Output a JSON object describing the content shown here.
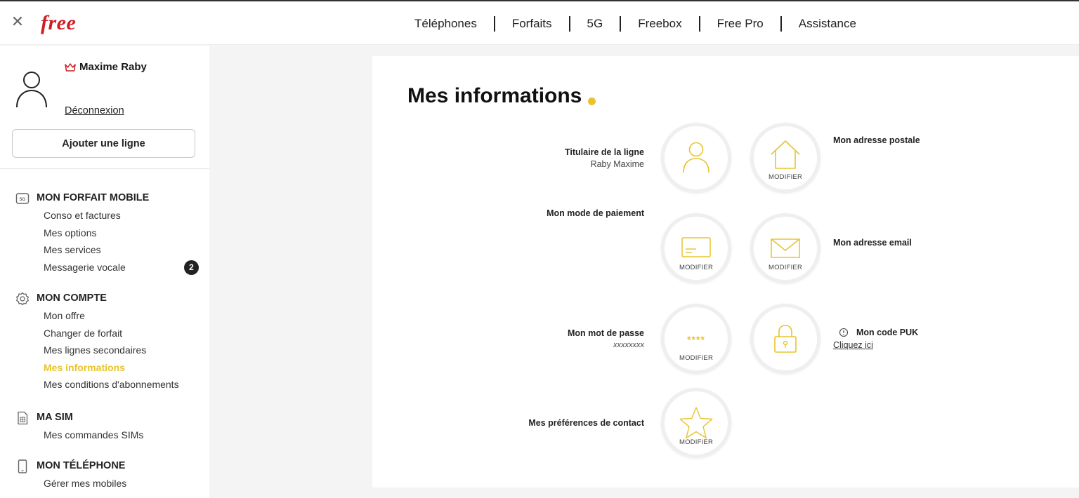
{
  "brand": {
    "logo_text": "free",
    "accent": "#cd1e25",
    "highlight": "#e8c32e"
  },
  "topbar": {
    "close_icon": "close-icon",
    "nav": [
      "Téléphones",
      "Forfaits",
      "5G",
      "Freebox",
      "Free Pro",
      "Assistance"
    ]
  },
  "sidebar": {
    "user_name": "Maxime Raby",
    "logout": "Déconnexion",
    "add_line": "Ajouter une ligne",
    "sections": [
      {
        "icon": "5g-icon",
        "title": "MON FORFAIT MOBILE",
        "links": [
          "Conso et factures",
          "Mes options",
          "Mes services",
          "Messagerie vocale"
        ],
        "badge": "2"
      },
      {
        "icon": "gear-icon",
        "title": "MON COMPTE",
        "links": [
          "Mon offre",
          "Changer de forfait",
          "Mes lignes secondaires",
          "Mes informations",
          "Mes conditions d'abonnements"
        ],
        "active": "Mes informations"
      },
      {
        "icon": "sim-icon",
        "title": "MA SIM",
        "links": [
          "Mes commandes SIMs"
        ]
      },
      {
        "icon": "phone-icon",
        "title": "MON TÉLÉPHONE",
        "links": [
          "Gérer mes mobiles"
        ]
      }
    ]
  },
  "main": {
    "title": "Mes informations",
    "modifier": "MODIFIER",
    "titulaire": {
      "label": "Titulaire de la ligne",
      "value": "Raby Maxime"
    },
    "adresse_postale": {
      "label": "Mon adresse postale"
    },
    "paiement": {
      "label": "Mon mode de paiement"
    },
    "email": {
      "label": "Mon adresse email"
    },
    "password": {
      "label": "Mon mot de passe",
      "value": "xxxxxxxx",
      "stars": "****"
    },
    "puk": {
      "label": "Mon code PUK",
      "link": "Cliquez ici"
    },
    "contact": {
      "label": "Mes préférences de contact"
    }
  }
}
